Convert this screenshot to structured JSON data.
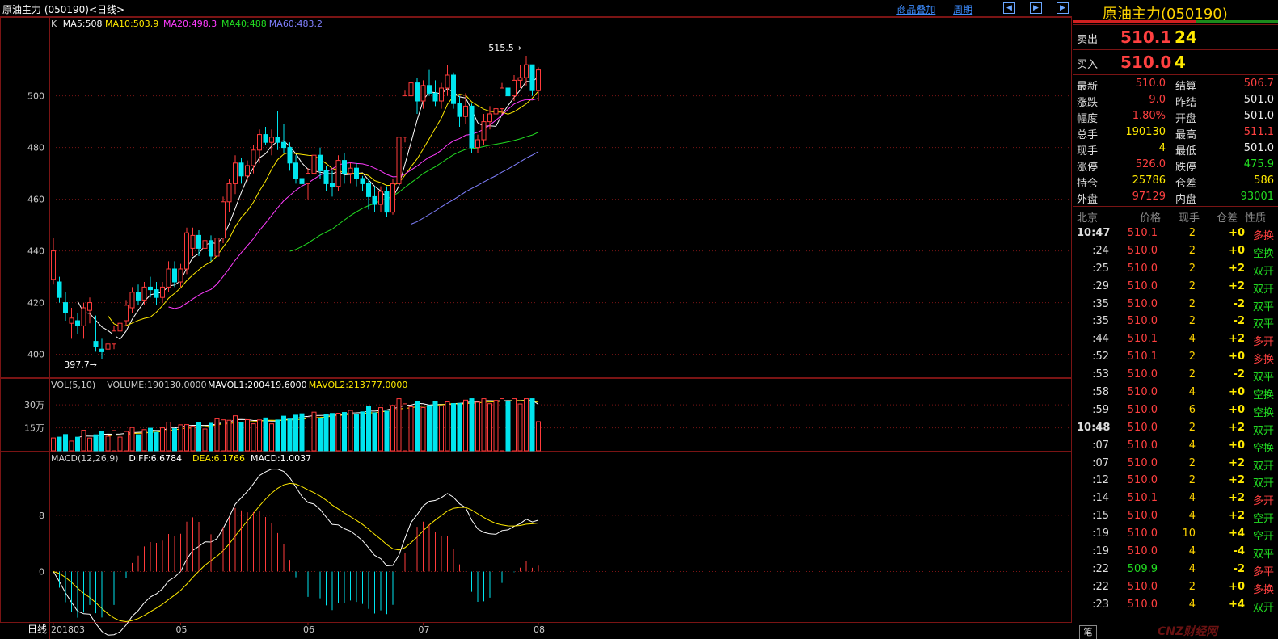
{
  "window": {
    "title": "原油主力 (050190)",
    "period_tag": "<日线>",
    "tools": [
      "商品叠加",
      "周期"
    ]
  },
  "chart_data": [
    {
      "type": "candlestick",
      "title": "K",
      "indicators": [
        {
          "name": "MA5",
          "value": 508.0,
          "color": "#ffffff"
        },
        {
          "name": "MA10",
          "value": 503.9,
          "color": "#ffea00"
        },
        {
          "name": "MA20",
          "value": 498.3,
          "color": "#ff3cff"
        },
        {
          "name": "MA40",
          "value": 488.0,
          "color": "#22dd22"
        },
        {
          "name": "MA60",
          "value": 483.2,
          "color": "#8080ff"
        }
      ],
      "ylim": [
        393,
        523
      ],
      "y_ticks": [
        400,
        420,
        440,
        460,
        480,
        500
      ],
      "x_ticks": [
        "201803",
        "05",
        "06",
        "07",
        "08"
      ],
      "annotations": [
        {
          "text": "515.5",
          "kind": "high"
        },
        {
          "text": "397.7",
          "kind": "low"
        }
      ],
      "ohlc": [
        [
          429,
          445,
          427,
          440
        ],
        [
          428,
          430,
          420,
          422
        ],
        [
          420,
          424,
          413,
          416
        ],
        [
          412,
          418,
          406,
          414
        ],
        [
          413,
          416,
          408,
          411
        ],
        [
          411,
          420,
          406,
          418
        ],
        [
          417,
          422,
          412,
          420
        ],
        [
          405,
          415,
          401,
          403
        ],
        [
          402,
          406,
          398,
          401
        ],
        [
          402,
          405,
          398,
          404
        ],
        [
          404,
          411,
          402,
          409
        ],
        [
          409,
          414,
          407,
          412
        ],
        [
          413,
          421,
          411,
          419
        ],
        [
          418,
          426,
          416,
          424
        ],
        [
          424,
          427,
          419,
          421
        ],
        [
          421,
          428,
          419,
          426
        ],
        [
          426,
          430,
          422,
          425
        ],
        [
          425,
          428,
          419,
          422
        ],
        [
          422,
          428,
          420,
          426
        ],
        [
          426,
          436,
          424,
          433
        ],
        [
          433,
          436,
          426,
          428
        ],
        [
          428,
          435,
          426,
          433
        ],
        [
          433,
          449,
          431,
          447
        ],
        [
          441,
          449,
          438,
          446
        ],
        [
          446,
          448,
          438,
          441
        ],
        [
          441,
          447,
          439,
          444
        ],
        [
          444,
          446,
          436,
          438
        ],
        [
          438,
          447,
          436,
          445
        ],
        [
          445,
          461,
          443,
          459
        ],
        [
          459,
          468,
          455,
          466
        ],
        [
          466,
          477,
          462,
          474
        ],
        [
          474,
          476,
          466,
          469
        ],
        [
          469,
          475,
          467,
          473
        ],
        [
          473,
          481,
          470,
          479
        ],
        [
          479,
          487,
          474,
          485
        ],
        [
          485,
          488,
          481,
          482
        ],
        [
          482,
          487,
          477,
          484
        ],
        [
          484,
          494,
          479,
          482
        ],
        [
          482,
          489,
          478,
          480
        ],
        [
          480,
          482,
          471,
          474
        ],
        [
          474,
          477,
          466,
          468
        ],
        [
          468,
          471,
          455,
          466
        ],
        [
          466,
          472,
          460,
          470
        ],
        [
          470,
          481,
          467,
          477
        ],
        [
          477,
          480,
          468,
          471
        ],
        [
          471,
          473,
          463,
          466
        ],
        [
          466,
          471,
          461,
          465
        ],
        [
          465,
          477,
          463,
          475
        ],
        [
          475,
          478,
          466,
          470
        ],
        [
          470,
          474,
          466,
          472
        ],
        [
          472,
          474,
          465,
          468
        ],
        [
          468,
          469,
          463,
          466
        ],
        [
          466,
          468,
          456,
          461
        ],
        [
          461,
          465,
          455,
          458
        ],
        [
          458,
          465,
          455,
          463
        ],
        [
          463,
          465,
          453,
          455
        ],
        [
          455,
          468,
          454,
          466
        ],
        [
          466,
          486,
          462,
          484
        ],
        [
          484,
          502,
          482,
          500
        ],
        [
          500,
          511,
          497,
          505
        ],
        [
          505,
          507,
          493,
          498
        ],
        [
          498,
          506,
          495,
          504
        ],
        [
          504,
          510,
          500,
          501
        ],
        [
          501,
          506,
          496,
          498
        ],
        [
          498,
          505,
          495,
          503
        ],
        [
          503,
          512,
          500,
          508
        ],
        [
          508,
          509,
          495,
          497
        ],
        [
          497,
          500,
          488,
          492
        ],
        [
          492,
          501,
          489,
          496
        ],
        [
          496,
          497,
          478,
          480
        ],
        [
          480,
          485,
          478,
          483
        ],
        [
          483,
          493,
          481,
          490
        ],
        [
          490,
          496,
          487,
          493
        ],
        [
          493,
          497,
          490,
          495
        ],
        [
          495,
          505,
          493,
          503
        ],
        [
          503,
          508,
          497,
          500
        ],
        [
          500,
          508,
          498,
          506
        ],
        [
          506,
          512,
          503,
          507
        ],
        [
          507,
          515.5,
          504,
          512
        ],
        [
          512,
          512,
          500,
          502
        ],
        [
          502,
          511,
          498,
          510
        ]
      ]
    },
    {
      "type": "bar",
      "title": "VOL(5,10)",
      "indicators": [
        {
          "name": "VOLUME",
          "value": "190130.0000",
          "color": "#cccccc"
        },
        {
          "name": "MAVOL1",
          "value": "200419.6000",
          "color": "#ffffff"
        },
        {
          "name": "MAVOL2",
          "value": "213777.0000",
          "color": "#ffea00"
        }
      ],
      "y_ticks": [
        {
          "value": 150000,
          "label": "15万"
        },
        {
          "value": 300000,
          "label": "30万"
        }
      ],
      "ylim": [
        0,
        380000
      ]
    },
    {
      "type": "line",
      "title": "MACD(12,26,9)",
      "indicators": [
        {
          "name": "DIFF",
          "value": 6.6784,
          "color": "#ffffff"
        },
        {
          "name": "DEA",
          "value": 6.1766,
          "color": "#ffea00"
        },
        {
          "name": "MACD",
          "value": 1.0037,
          "color": "#ffffff"
        }
      ],
      "y_ticks": [
        0,
        8
      ],
      "ylim": [
        -6.5,
        15
      ]
    }
  ],
  "quote": {
    "name": "原油主力(050190)",
    "sell": {
      "label": "卖出",
      "price": "510.1",
      "volume": "24"
    },
    "buy": {
      "label": "买入",
      "price": "510.0",
      "volume": "4"
    },
    "stats": [
      {
        "l1": "最新",
        "v1": "510.0",
        "c1": "red",
        "l2": "结算",
        "v2": "506.7",
        "c2": "red"
      },
      {
        "l1": "涨跌",
        "v1": "9.0",
        "c1": "red",
        "l2": "昨结",
        "v2": "501.0",
        "c2": "wht"
      },
      {
        "l1": "幅度",
        "v1": "1.80%",
        "c1": "red",
        "l2": "开盘",
        "v2": "501.0",
        "c2": "wht"
      },
      {
        "l1": "总手",
        "v1": "190130",
        "c1": "yel",
        "l2": "最高",
        "v2": "511.1",
        "c2": "red"
      },
      {
        "l1": "现手",
        "v1": "4",
        "c1": "yel",
        "l2": "最低",
        "v2": "501.0",
        "c2": "wht"
      },
      {
        "l1": "涨停",
        "v1": "526.0",
        "c1": "red",
        "l2": "跌停",
        "v2": "475.9",
        "c2": "grn"
      },
      {
        "l1": "持仓",
        "v1": "25786",
        "c1": "yel",
        "l2": "仓差",
        "v2": "586",
        "c2": "yel"
      },
      {
        "l1": "外盘",
        "v1": "97129",
        "c1": "red",
        "l2": "内盘",
        "v2": "93001",
        "c2": "grn"
      }
    ],
    "ticks_header": [
      "北京",
      "价格",
      "现手",
      "仓差",
      "性质"
    ],
    "ticks": [
      {
        "time": "10:47",
        "price": "510.1",
        "vol": "2",
        "oi": "+0",
        "type": "多换"
      },
      {
        "time": ":24",
        "price": "510.0",
        "vol": "2",
        "oi": "+0",
        "type": "空换"
      },
      {
        "time": ":25",
        "price": "510.0",
        "vol": "2",
        "oi": "+2",
        "type": "双开"
      },
      {
        "time": ":29",
        "price": "510.0",
        "vol": "2",
        "oi": "+2",
        "type": "双开"
      },
      {
        "time": ":35",
        "price": "510.0",
        "vol": "2",
        "oi": "-2",
        "type": "双平"
      },
      {
        "time": ":35",
        "price": "510.0",
        "vol": "2",
        "oi": "-2",
        "type": "双平"
      },
      {
        "time": ":44",
        "price": "510.1",
        "vol": "4",
        "oi": "+2",
        "type": "多开"
      },
      {
        "time": ":52",
        "price": "510.1",
        "vol": "2",
        "oi": "+0",
        "type": "多换"
      },
      {
        "time": ":53",
        "price": "510.0",
        "vol": "2",
        "oi": "-2",
        "type": "双平"
      },
      {
        "time": ":58",
        "price": "510.0",
        "vol": "4",
        "oi": "+0",
        "type": "空换"
      },
      {
        "time": ":59",
        "price": "510.0",
        "vol": "6",
        "oi": "+0",
        "type": "空换"
      },
      {
        "time": "10:48",
        "price": "510.0",
        "vol": "2",
        "oi": "+2",
        "type": "双开"
      },
      {
        "time": ":07",
        "price": "510.0",
        "vol": "4",
        "oi": "+0",
        "type": "空换"
      },
      {
        "time": ":07",
        "price": "510.0",
        "vol": "2",
        "oi": "+2",
        "type": "双开"
      },
      {
        "time": ":12",
        "price": "510.0",
        "vol": "2",
        "oi": "+2",
        "type": "双开"
      },
      {
        "time": ":14",
        "price": "510.1",
        "vol": "4",
        "oi": "+2",
        "type": "多开"
      },
      {
        "time": ":15",
        "price": "510.0",
        "vol": "4",
        "oi": "+2",
        "type": "空开"
      },
      {
        "time": ":19",
        "price": "510.0",
        "vol": "10",
        "oi": "+4",
        "type": "空开"
      },
      {
        "time": ":19",
        "price": "510.0",
        "vol": "4",
        "oi": "-4",
        "type": "双平"
      },
      {
        "time": ":22",
        "price": "509.9",
        "vol": "4",
        "oi": "-2",
        "type": "多平"
      },
      {
        "time": ":22",
        "price": "510.0",
        "vol": "2",
        "oi": "+0",
        "type": "多换"
      },
      {
        "time": ":23",
        "price": "510.0",
        "vol": "4",
        "oi": "+4",
        "type": "双开"
      }
    ]
  },
  "bottom_tab": "笔",
  "period_label": "日线"
}
